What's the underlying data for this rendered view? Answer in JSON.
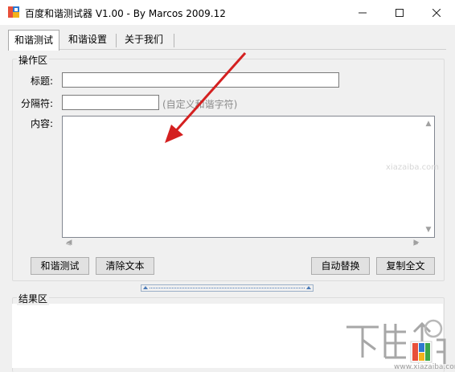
{
  "window": {
    "title": "百度和谐测试器 V1.00 - By Marcos 2009.12"
  },
  "tabs": [
    {
      "label": "和谐测试",
      "active": true
    },
    {
      "label": "和谐设置",
      "active": false
    },
    {
      "label": "关于我们",
      "active": false
    }
  ],
  "operation_group": {
    "label": "操作区",
    "title_label": "标题:",
    "title_value": "",
    "separator_label": "分隔符:",
    "separator_value": "",
    "separator_hint": "(自定义和谐字符)",
    "content_label": "内容:",
    "content_value": ""
  },
  "buttons": {
    "test": "和谐测试",
    "clear": "清除文本",
    "auto_replace": "自动替换",
    "copy_all": "复制全文"
  },
  "result_group": {
    "label": "结果区"
  },
  "watermark": {
    "text": "www.xiazaiba.com",
    "faint_text": "xiazaiba.com"
  },
  "colors": {
    "arrow": "#d42020",
    "accent": "#4a7ab8"
  }
}
